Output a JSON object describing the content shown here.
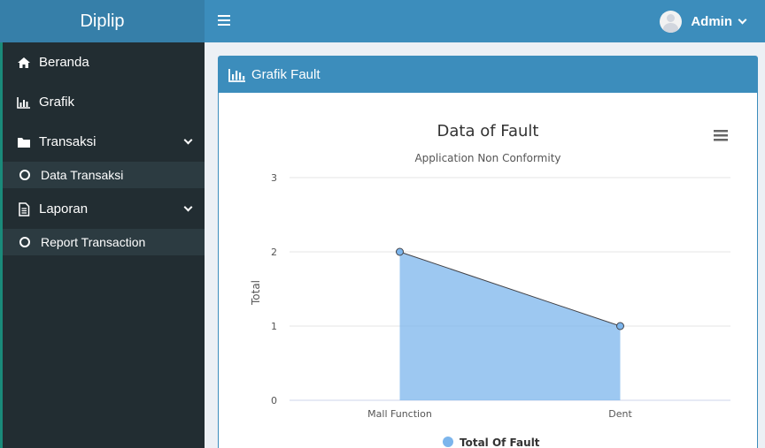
{
  "app": {
    "title": "Diplip"
  },
  "header": {
    "user_name": "Admin"
  },
  "sidebar": {
    "items": [
      {
        "label": "Beranda",
        "icon": "home-icon"
      },
      {
        "label": "Grafik",
        "icon": "bar-chart-icon"
      },
      {
        "label": "Transaksi",
        "icon": "folder-icon",
        "expanded": true,
        "children": [
          {
            "label": "Data Transaksi"
          }
        ]
      },
      {
        "label": "Laporan",
        "icon": "file-icon",
        "expanded": true,
        "children": [
          {
            "label": "Report Transaction"
          }
        ]
      }
    ]
  },
  "box": {
    "title": "Grafik Fault"
  },
  "colors": {
    "header": "#3c8dbc",
    "logo": "#367fa9",
    "sidebar": "#222d32",
    "submenu": "#2c3b41",
    "area": "#7cb5ec"
  },
  "chart_data": {
    "type": "area",
    "title": "Data of Fault",
    "subtitle": "Application Non Conformity",
    "categories": [
      "Mall Function",
      "Dent"
    ],
    "ylabel": "Total",
    "ylim": [
      0,
      3
    ],
    "yticks": [
      0,
      1,
      2,
      3
    ],
    "grid": true,
    "legend_position": "bottom-center",
    "series": [
      {
        "name": "Total Of Fault",
        "values": [
          2,
          1
        ]
      }
    ]
  }
}
